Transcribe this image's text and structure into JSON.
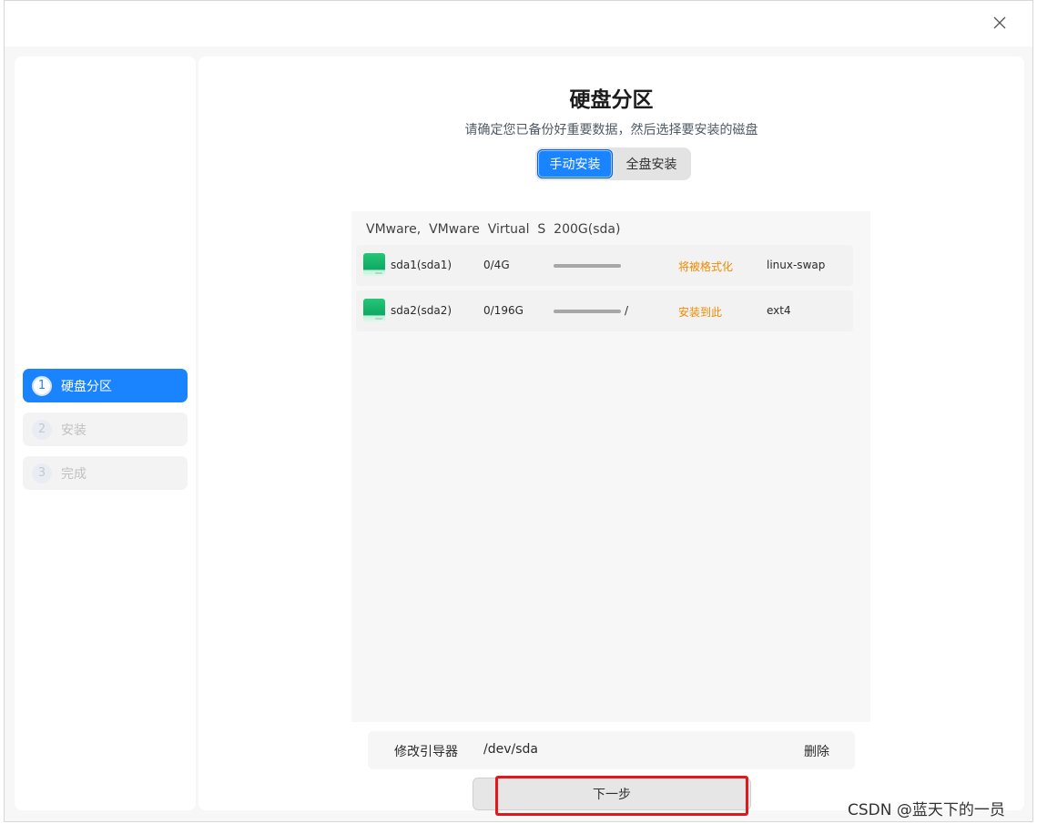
{
  "window": {
    "close_icon": "close-icon"
  },
  "sidebar": {
    "steps": [
      {
        "number": "1",
        "label": "硬盘分区",
        "state": "active"
      },
      {
        "number": "2",
        "label": "安装",
        "state": "inactive"
      },
      {
        "number": "3",
        "label": "完成",
        "state": "inactive"
      }
    ]
  },
  "main": {
    "title": "硬盘分区",
    "subtitle": "请确定您已备份好重要数据，然后选择要安装的磁盘",
    "mode_tabs": {
      "manual": "手动安装",
      "full": "全盘安装",
      "selected": "manual"
    },
    "disk": {
      "header": "VMware,  VMware  Virtual  S  200G(sda)",
      "partitions": [
        {
          "name": "sda1(sda1)",
          "usage": "0/4G",
          "mount": "",
          "status": "将被格式化",
          "filesystem": "linux-swap",
          "icon": "disk-icon"
        },
        {
          "name": "sda2(sda2)",
          "usage": "0/196G",
          "mount": "/",
          "status": "安装到此",
          "filesystem": "ext4",
          "icon": "disk-icon"
        }
      ]
    },
    "bootloader": {
      "label": "修改引导器",
      "value": "/dev/sda",
      "delete_label": "删除"
    },
    "next_label": "下一步"
  },
  "watermark": "CSDN @蓝天下的一员",
  "colors": {
    "accent": "#1a84ff",
    "warning_text": "#f08a00",
    "highlight": "#e3171b"
  }
}
